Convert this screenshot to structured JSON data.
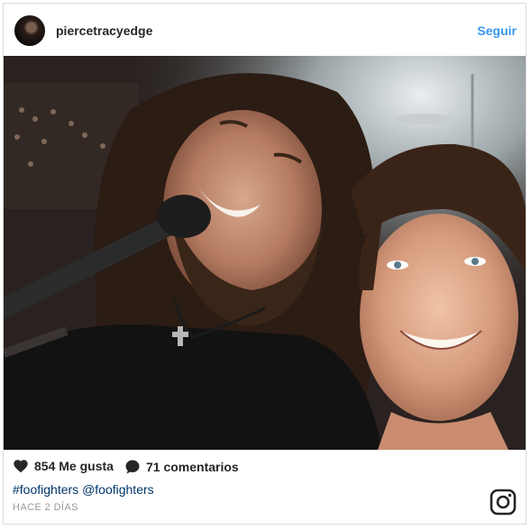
{
  "post": {
    "username": "piercetracyedge",
    "follow_label": "Seguir",
    "likes_text": "854 Me gusta",
    "comments_text": "71 comentarios",
    "hashtag": "#foofighters",
    "mention": "@foofighters",
    "timestamp": "HACE 2 DÍAS"
  },
  "icons": {
    "like": "heart-icon",
    "comment": "comment-bubble-icon",
    "brand": "instagram-logo-icon"
  },
  "colors": {
    "link": "#3897f0",
    "hashtag": "#003569",
    "text": "#262626",
    "muted": "#999999"
  }
}
